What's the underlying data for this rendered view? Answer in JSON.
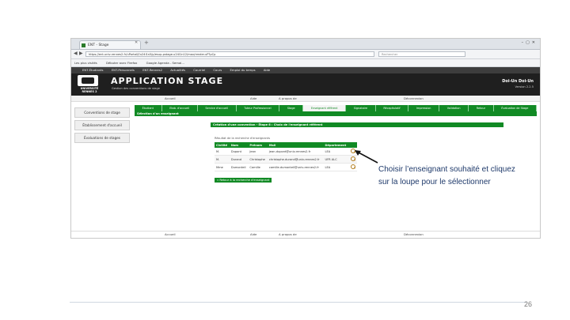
{
  "browser": {
    "tab_title": "ENT - Stage",
    "url": "https://ent.univ-rennes2.fr/uPortal/f/u24l1s5/p/esup-pstage.u24l1n12/max/render.uP?pCp",
    "search_placeholder": "Rechercher",
    "bookmarks": [
      "Les plus visités",
      "Débuter avec Firefox",
      "Google Agenda - Semai...",
      "ENT-Étudiants",
      "ENT-Personnels",
      "ENT-Rennes2",
      "Actualités",
      "Courriel",
      "Cours",
      "Emploi du temps",
      "Aide"
    ]
  },
  "app": {
    "nav_items": [
      "ENT-Étudiants",
      "ENT-Personnels",
      "ENT-Rennes2",
      "Actualités",
      "Courriel",
      "Cours",
      "Emploi du temps",
      "Aide"
    ],
    "logo_text": "UNIVERSITÉ RENNES 2",
    "title": "APPLICATION STAGE",
    "subtitle": "Gestion des conventions de stage",
    "user_name": "Doi-Un Doi-Un",
    "version": "Version 2.2.5",
    "status_left": "Accueil",
    "status_mid": "Aide",
    "status_mid2": "A propos de",
    "status_right": "Déconnexion"
  },
  "sidebar": {
    "items": [
      "Conventions de stage",
      "Établissement d'accueil",
      "Évaluations de stages"
    ]
  },
  "steps": {
    "tabs": [
      "Étudiant",
      "Etab. d'accueil",
      "Service d'accueil",
      "Tuteur Professionnel",
      "Stage",
      "Enseignant référent",
      "Signataire",
      "Récapitulatif",
      "Impression",
      "Validation",
      "Retour",
      "Évaluation de Stage"
    ],
    "active_index": 5
  },
  "main": {
    "section_header": "Sélection d'un enseignant",
    "panel_header": "Création d'une convention - Étape 6 : Choix de l'enseignant référent",
    "list_title": "Résultat de la recherche d'enseignants",
    "columns": [
      "Civilité",
      "Nom",
      "Prénom",
      "Mail",
      "Département"
    ],
    "rows": [
      [
        "M.",
        "Dupont",
        "Jean",
        "jean.dupont@univ-rennes2.fr",
        "LEA"
      ],
      [
        "M.",
        "Durand",
        "Christophe",
        "christophe.durand@univ-rennes2.fr",
        "UFR ALC"
      ],
      [
        "Mme",
        "Dumonteil",
        "Camille",
        "camille.dumonteil@univ-rennes2.fr",
        "LEA"
      ]
    ],
    "return_button": "« Retour à la recherche d'enseignant"
  },
  "footer": {
    "left": "Accueil",
    "mid": "Aide",
    "mid2": "A propos de",
    "right": "Déconnexion"
  },
  "annotation": {
    "line1": "Choisir l’enseignant souhaité et cliquez",
    "line2": "sur la loupe pour le sélectionner"
  },
  "page_number": "26",
  "colors": {
    "accent_green": "#118a24",
    "header_dark": "#1f1f1f",
    "annotation_text": "#1f3a6b"
  }
}
